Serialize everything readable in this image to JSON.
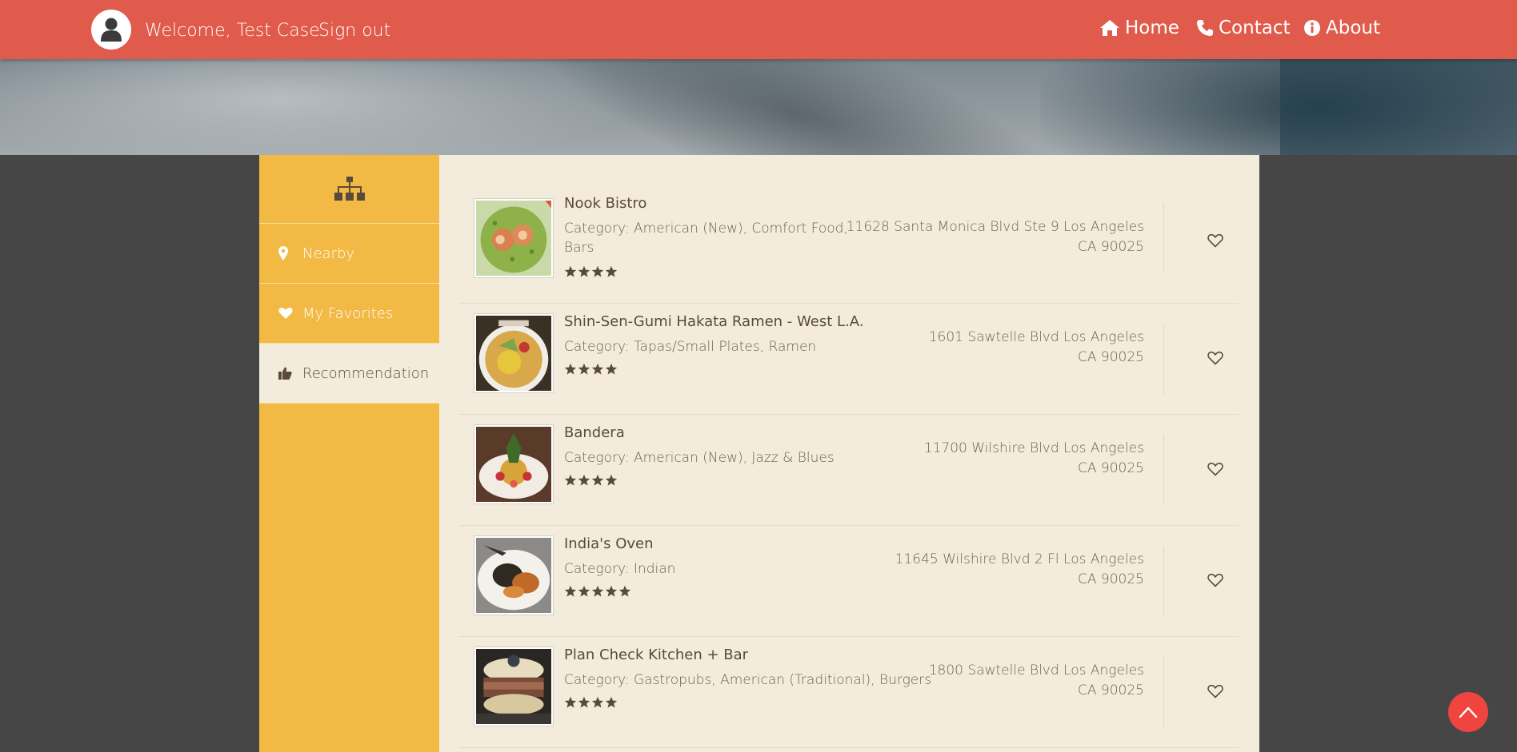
{
  "header": {
    "welcome": "Welcome, Test Case",
    "signout": "Sign out",
    "nav": [
      {
        "label": "Home",
        "icon": "home-icon"
      },
      {
        "label": "Contact",
        "icon": "phone-icon"
      },
      {
        "label": "About",
        "icon": "info-icon"
      }
    ]
  },
  "sidebar": {
    "head_icon": "sitemap-icon",
    "items": [
      {
        "label": "Nearby",
        "icon": "map-marker-icon"
      },
      {
        "label": "My Favorites",
        "icon": "heart-icon"
      },
      {
        "label": "Recommendation",
        "icon": "thumbs-up-icon",
        "active": true
      }
    ]
  },
  "restaurants": [
    {
      "name": "Nook Bistro",
      "category": "Category: American (New), Comfort Food, Bars",
      "rating": 4,
      "address1": "11628 Santa Monica Blvd Ste 9 Los Angeles",
      "address2": "CA 90025"
    },
    {
      "name": "Shin-Sen-Gumi Hakata Ramen - West L.A.",
      "category": "Category: Tapas/Small Plates, Ramen",
      "rating": 4,
      "address1": "1601 Sawtelle Blvd Los Angeles",
      "address2": "CA 90025"
    },
    {
      "name": "Bandera",
      "category": "Category: American (New), Jazz & Blues",
      "rating": 4,
      "address1": "11700 Wilshire Blvd Los Angeles",
      "address2": "CA 90025"
    },
    {
      "name": "India's Oven",
      "category": "Category: Indian",
      "rating": 5,
      "address1": "11645 Wilshire Blvd 2 Fl Los Angeles",
      "address2": "CA 90025"
    },
    {
      "name": "Plan Check Kitchen + Bar",
      "category": "Category: Gastropubs, American (Traditional), Burgers",
      "rating": 4,
      "address1": "1800 Sawtelle Blvd Los Angeles",
      "address2": "CA 90025"
    }
  ],
  "colors": {
    "header": "#e05b4c",
    "sidebar": "#f2b944",
    "content": "#f3ecdc",
    "text": "#5b4a3c",
    "back_to_top": "#f0453f"
  }
}
